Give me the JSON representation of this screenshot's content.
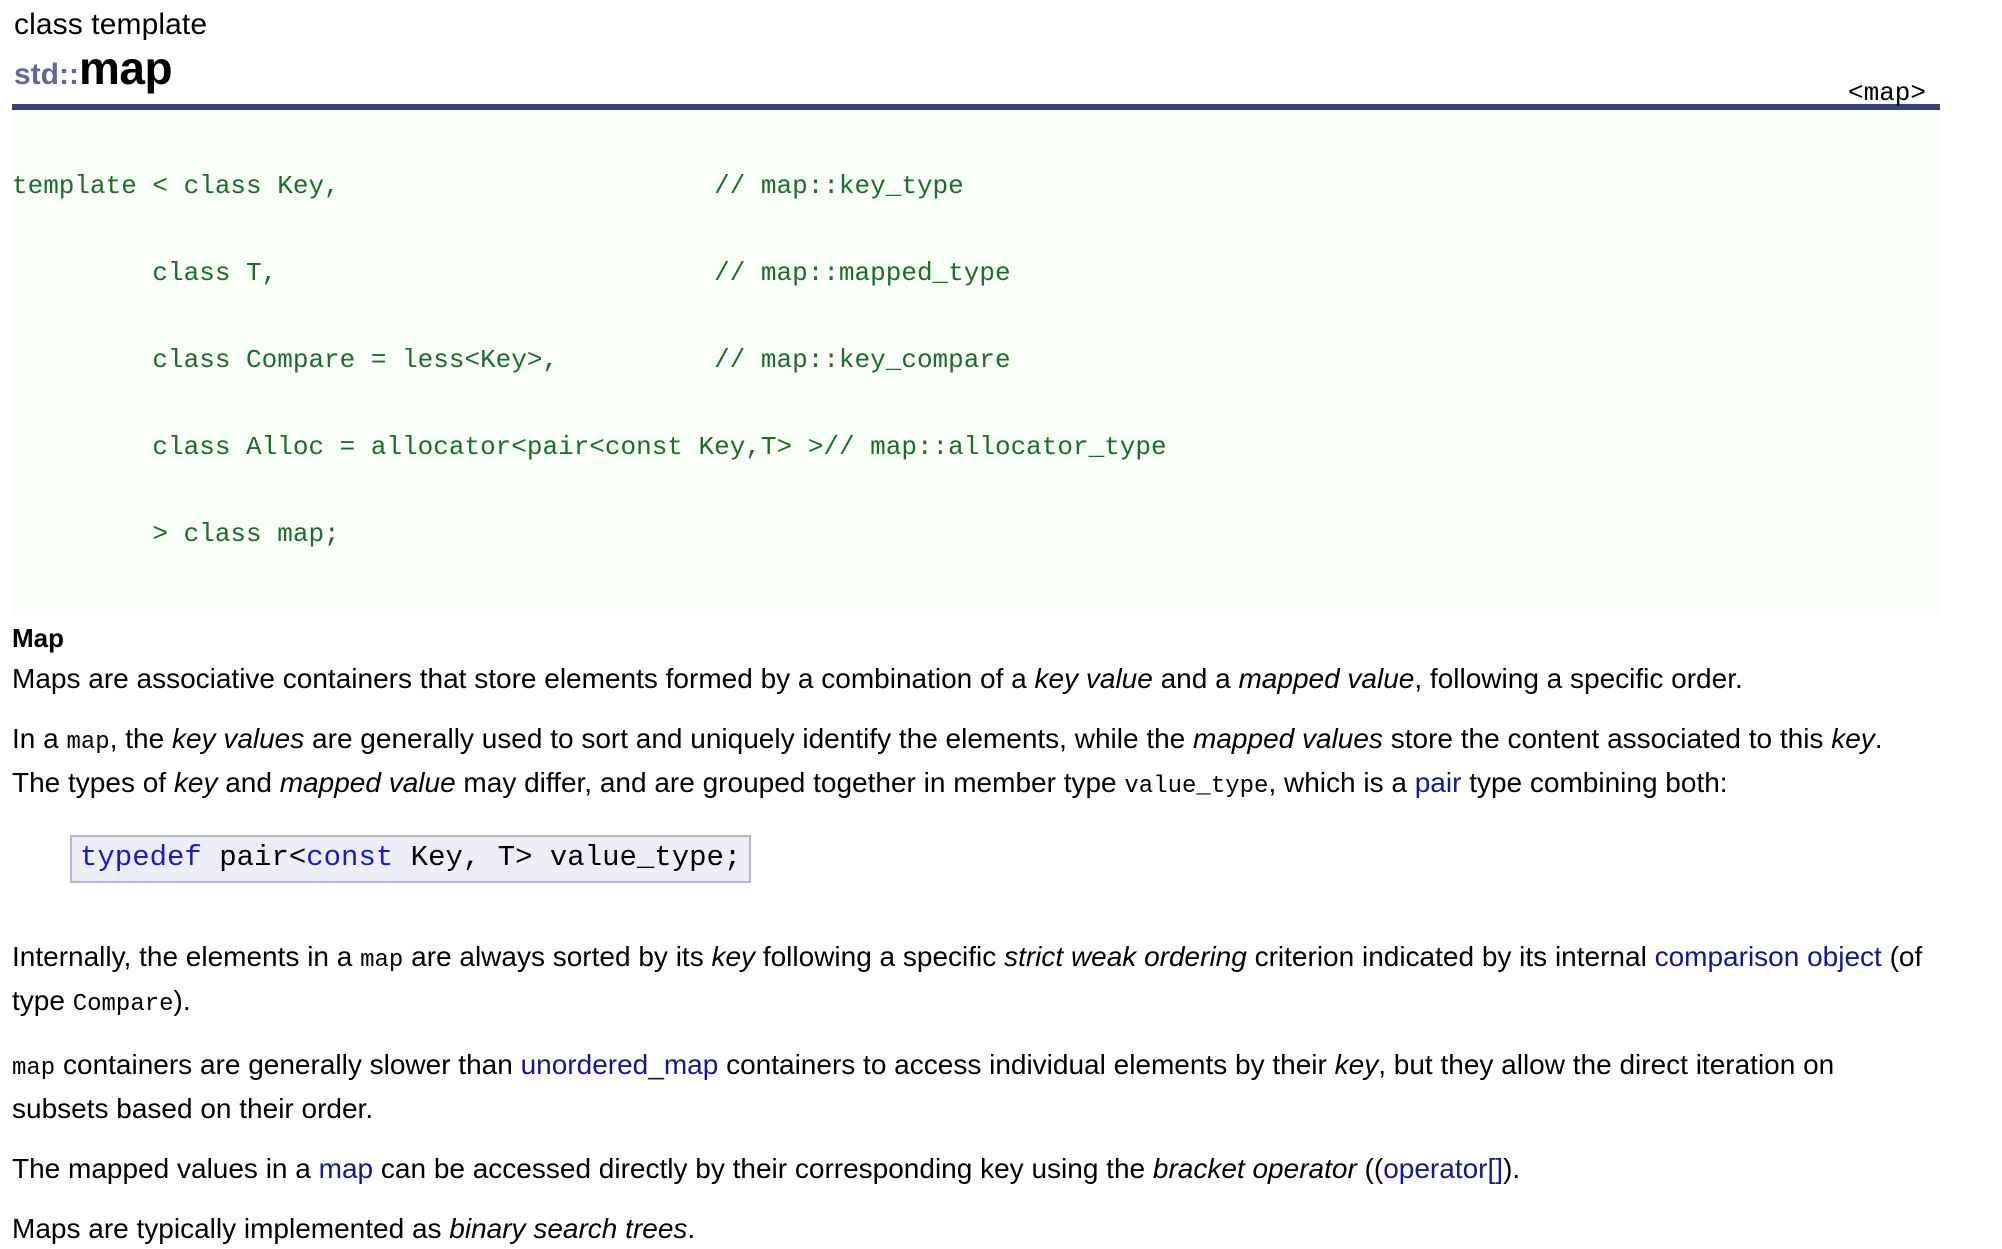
{
  "header": {
    "kind": "class template",
    "namespace": "std::",
    "name": "map",
    "include": "<map>"
  },
  "prototype": {
    "lines": [
      {
        "code": "template < class Key,",
        "comment": "// map::key_type"
      },
      {
        "code": "         class T,",
        "comment": "// map::mapped_type"
      },
      {
        "code": "         class Compare = less<Key>,",
        "comment": "// map::key_compare"
      },
      {
        "code": "         class Alloc = allocator<pair<const Key,T> >",
        "comment": "// map::allocator_type"
      },
      {
        "code": "         > class map;",
        "comment": ""
      }
    ]
  },
  "body": {
    "section_title": "Map",
    "p1": {
      "t1": "Maps are associative containers that store elements formed by a combination of a ",
      "i1": "key value",
      "t2": " and a ",
      "i2": "mapped value",
      "t3": ", following a specific order."
    },
    "p2": {
      "t1": "In a ",
      "c1": "map",
      "t2": ", the ",
      "i1": "key values",
      "t3": " are generally used to sort and uniquely identify the elements, while the ",
      "i2": "mapped values",
      "t4": " store the content associated to this ",
      "i3": "key",
      "t5": ". The types of ",
      "i4": "key",
      "t6": " and ",
      "i5": "mapped value",
      "t7": " may differ, and are grouped together in member type ",
      "c2": "value_type",
      "t8": ", which is a ",
      "link1": "pair",
      "t9": " type combining both:"
    },
    "snippet": {
      "kw1": "typedef",
      "mid": " pair<",
      "kw2": "const",
      "tail": " Key, T> value_type;"
    },
    "p3": {
      "t1": "Internally, the elements in a ",
      "c1": "map",
      "t2": " are always sorted by its ",
      "i1": "key",
      "t3": " following a specific ",
      "i2": "strict weak ordering",
      "t4": " criterion indicated by its internal ",
      "link1": "comparison object",
      "t5": " (of type ",
      "c2": "Compare",
      "t6": ")."
    },
    "p4": {
      "c1": "map",
      "t1": " containers are generally slower than ",
      "link1": "unordered_map",
      "t2": " containers to access individual elements by their ",
      "i1": "key",
      "t3": ", but they allow the direct iteration on subsets based on their order."
    },
    "p5": {
      "t1": "The mapped values in a ",
      "link1": "map",
      "t2": " can be accessed directly by their corresponding key using the ",
      "i1": "bracket operator",
      "t3": " ((",
      "link2": "operator[]",
      "t4": ")."
    },
    "p6": {
      "t1": "Maps are typically implemented as ",
      "i1": "binary search trees",
      "t2": "."
    }
  },
  "colors": {
    "rule": "#33417c",
    "namespace": "#666699",
    "code_text": "#1f6b29",
    "code_bg": "#f7fff7",
    "link": "#17178c",
    "snippet_bg": "#eeeef8",
    "snippet_border": "#b6b6cf",
    "snippet_keyword": "#1a1aca"
  }
}
